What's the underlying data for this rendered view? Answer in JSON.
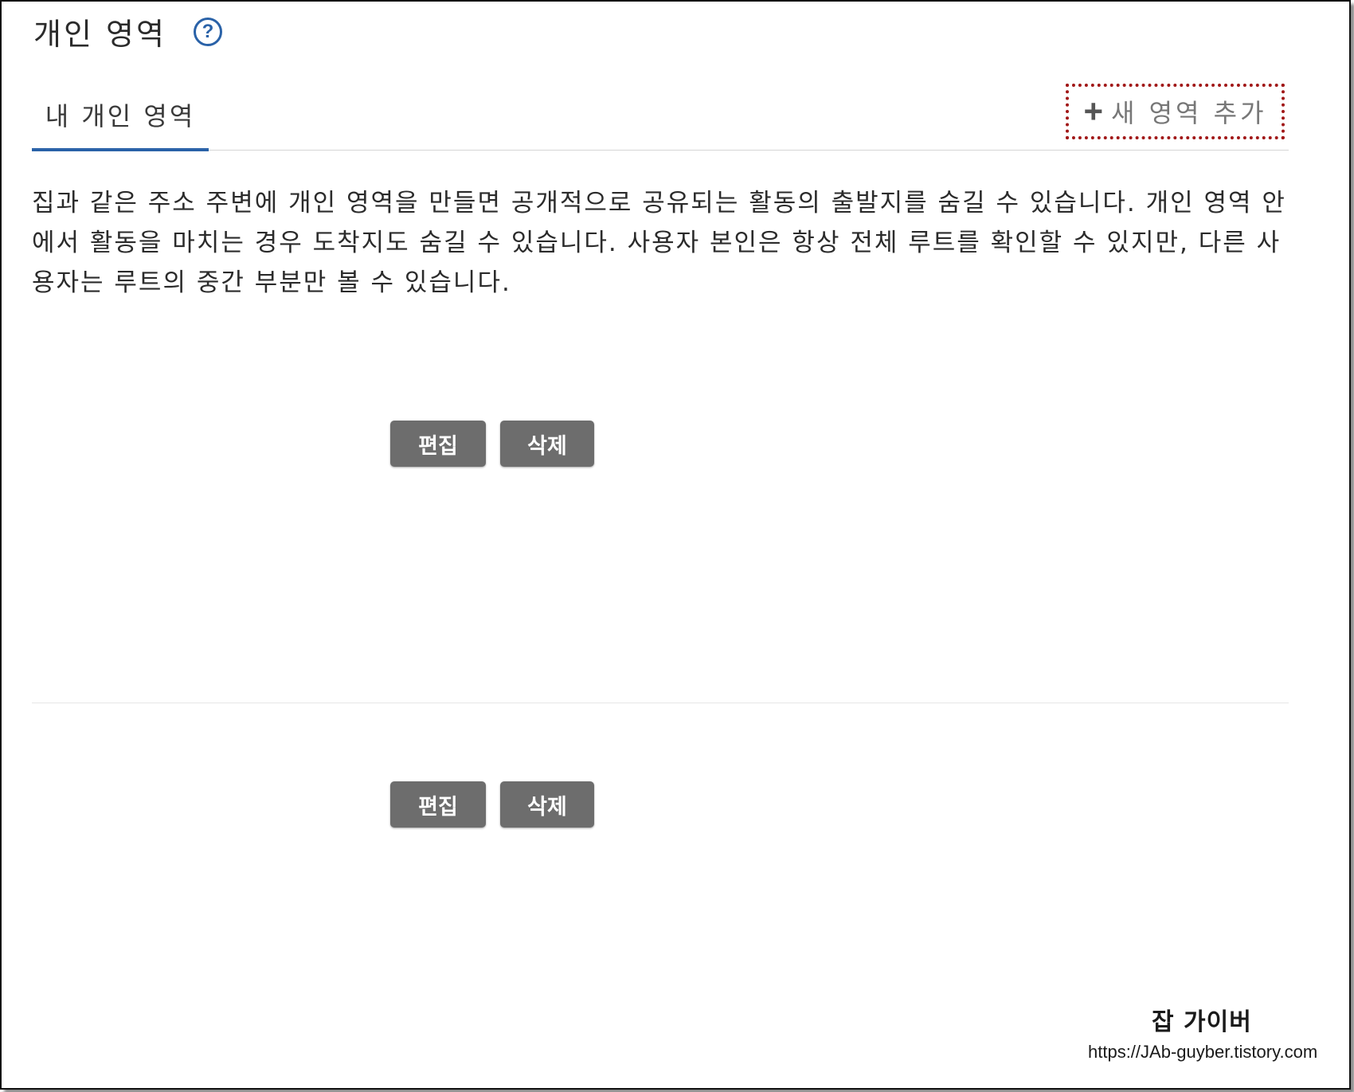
{
  "page": {
    "title": "개인 영역",
    "help_icon": "question-circle-icon"
  },
  "tabs": [
    {
      "label": "내 개인 영역",
      "active": true
    }
  ],
  "add_area": {
    "icon": "plus-icon",
    "icon_glyph": "+",
    "label": "새 영역 추가"
  },
  "description": "집과 같은 주소 주변에 개인 영역을 만들면 공개적으로 공유되는 활동의 출발지를 숨길 수 있습니다. 개인 영역 안에서 활동을 마치는 경우 도착지도 숨길 수 있습니다. 사용자 본인은 항상 전체 루트를 확인할 수 있지만, 다른 사용자는 루트의 중간 부분만 볼 수 있습니다.",
  "areas": [
    {
      "edit_label": "편집",
      "delete_label": "삭제"
    },
    {
      "edit_label": "편집",
      "delete_label": "삭제"
    }
  ],
  "watermark": {
    "name": "잡 가이버",
    "url": "https://JAb-guyber.tistory.com"
  },
  "colors": {
    "accent": "#2a62a8",
    "button": "#6d6d6d",
    "highlight_border": "#a11818"
  }
}
